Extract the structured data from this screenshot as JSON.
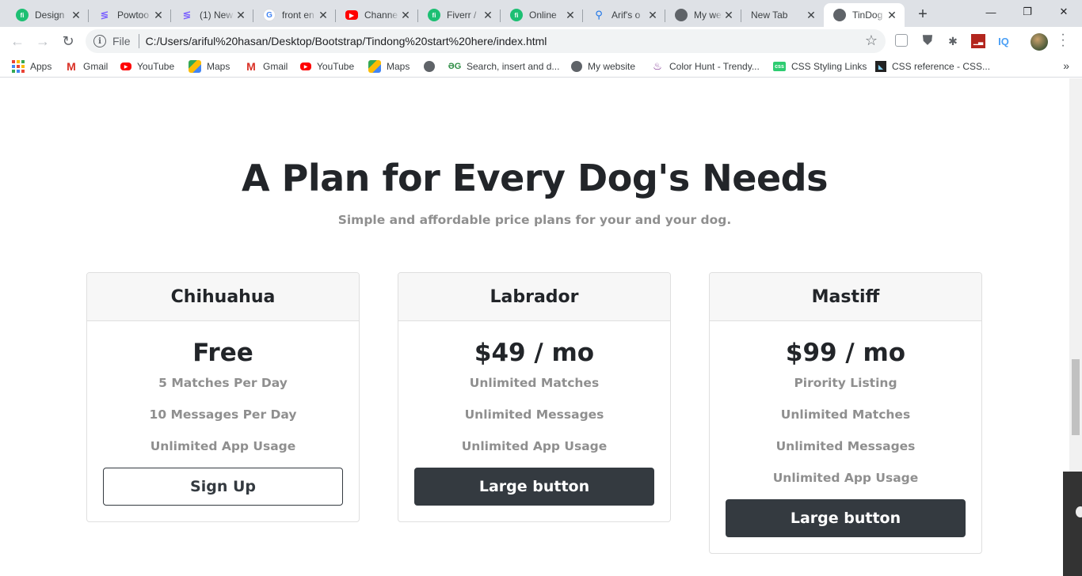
{
  "browser": {
    "tabs": [
      {
        "title": "Design",
        "icon": "fiverr-icon"
      },
      {
        "title": "Powtoo",
        "icon": "powtoon-icon"
      },
      {
        "title": "(1) New",
        "icon": "powtoon-icon"
      },
      {
        "title": "front en",
        "icon": "google-icon"
      },
      {
        "title": "Channe",
        "icon": "youtube-icon"
      },
      {
        "title": "Fiverr /",
        "icon": "fiverr-icon"
      },
      {
        "title": "Online",
        "icon": "fiverr-icon"
      },
      {
        "title": "Arif's o",
        "icon": "tree-icon"
      },
      {
        "title": "My web",
        "icon": "globe-icon"
      },
      {
        "title": "New Tab",
        "icon": ""
      },
      {
        "title": "TinDog",
        "icon": "globe-icon",
        "active": true
      }
    ],
    "address": {
      "scheme_label": "File",
      "url": "C:/Users/ariful%20hasan/Desktop/Bootstrap/Tindong%20start%20here/index.html"
    },
    "bookmarks": [
      {
        "label": "Apps",
        "icon": "apps-grid-icon"
      },
      {
        "label": "Gmail",
        "icon": "gmail-icon"
      },
      {
        "label": "YouTube",
        "icon": "youtube-icon"
      },
      {
        "label": "Maps",
        "icon": "maps-icon"
      },
      {
        "label": "Gmail",
        "icon": "gmail-icon"
      },
      {
        "label": "YouTube",
        "icon": "youtube-icon"
      },
      {
        "label": "Maps",
        "icon": "maps-icon"
      },
      {
        "label": "",
        "icon": "globe-icon"
      },
      {
        "label": "Search, insert and d...",
        "icon": "geeksforgeeks-icon"
      },
      {
        "label": "My website",
        "icon": "globe-icon"
      },
      {
        "label": "Color Hunt - Trendy...",
        "icon": "color-hunt-icon"
      },
      {
        "label": "CSS Styling Links",
        "icon": "css-icon"
      },
      {
        "label": "CSS reference - CSS...",
        "icon": "mdn-icon"
      }
    ],
    "extensions": [
      "pocket-icon",
      "shield-icon",
      "bug-icon",
      "chart-icon",
      "iq-icon"
    ],
    "extension_labels": {
      "iq": "IQ"
    }
  },
  "page": {
    "heading": "A Plan for Every Dog's Needs",
    "subheading": "Simple and affordable price plans for your and your dog.",
    "plans": [
      {
        "name": "Chihuahua",
        "price": "Free",
        "features": [
          "5 Matches Per Day",
          "10 Messages Per Day",
          "Unlimited App Usage"
        ],
        "button": "Sign Up",
        "button_style": "outline"
      },
      {
        "name": "Labrador",
        "price": "$49 / mo",
        "features": [
          "Unlimited Matches",
          "Unlimited Messages",
          "Unlimited App Usage"
        ],
        "button": "Large button",
        "button_style": "dark"
      },
      {
        "name": "Mastiff",
        "price": "$99 / mo",
        "features": [
          "Pirority Listing",
          "Unlimited Matches",
          "Unlimited Messages",
          "Unlimited App Usage"
        ],
        "button": "Large button",
        "button_style": "dark"
      }
    ]
  },
  "colors": {
    "tabstrip": "#dee1e6",
    "heading": "#222529",
    "muted": "#8f8f8f",
    "dark_button": "#343a40",
    "card_header": "#f7f7f7"
  }
}
